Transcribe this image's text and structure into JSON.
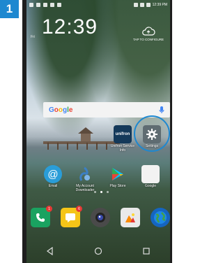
{
  "step_number": "1",
  "status_bar": {
    "time": "12:39 PM"
  },
  "lock_clock": {
    "time": "12:39",
    "day": "Fri"
  },
  "weather": {
    "label": "TAP TO CONFIGURE",
    "icon": "cloud-upload-icon"
  },
  "search_bar": {
    "brand": "Google",
    "icon": "mic-icon"
  },
  "apps_row1": [
    {
      "label": "Unifron Service Info",
      "icon": "unifron-icon",
      "color": "#14395a"
    },
    {
      "label": "Settings",
      "icon": "gear-icon",
      "color": "#5f6c72"
    }
  ],
  "apps_row2": [
    {
      "label": "Email",
      "icon": "at-icon",
      "color": "#2a9dd8"
    },
    {
      "label": "My Account Downloader",
      "icon": "downloader-icon",
      "color": "#3c7fc4"
    },
    {
      "label": "Play Store",
      "icon": "play-store-icon",
      "color": "#ffffff"
    },
    {
      "label": "Google",
      "icon": "google-folder-icon",
      "color": "#f2f2f2"
    }
  ],
  "dock": [
    {
      "name": "phone",
      "icon": "phone-icon",
      "color": "#1aa260",
      "badge": "1"
    },
    {
      "name": "messages",
      "icon": "messages-icon",
      "color": "#f5c518",
      "badge": "6"
    },
    {
      "name": "camera",
      "icon": "camera-icon",
      "color": "#4a4a4a"
    },
    {
      "name": "gallery",
      "icon": "gallery-icon",
      "color": "#e9e9e9"
    },
    {
      "name": "browser",
      "icon": "globe-icon",
      "color": "#1565c0"
    }
  ],
  "nav": [
    "back-icon",
    "home-icon",
    "recents-icon"
  ]
}
